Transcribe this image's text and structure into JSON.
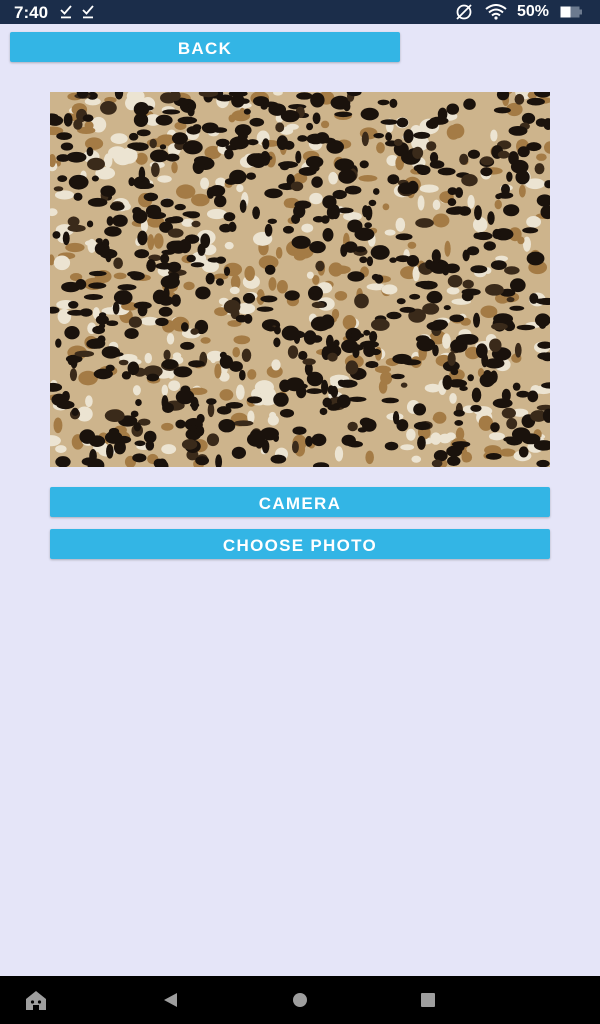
{
  "status_bar": {
    "time": "7:40",
    "battery_text": "50%",
    "icons": [
      "download-done-icon",
      "download-done-icon",
      "do-not-disturb-icon",
      "wifi-icon",
      "battery-icon"
    ]
  },
  "buttons": {
    "back": "BACK",
    "camera": "CAMERA",
    "choose_photo": "CHOOSE PHOTO"
  },
  "photo": {
    "subject": "leopard print fabric"
  },
  "nav_bar": {
    "icons": [
      "home-icon",
      "back-icon",
      "home-circle-icon",
      "recents-icon"
    ]
  },
  "colors": {
    "accent": "#33b5e5",
    "background": "#e5e5f8",
    "status_bar": "#1b2d4a",
    "nav_bar": "#000000"
  }
}
